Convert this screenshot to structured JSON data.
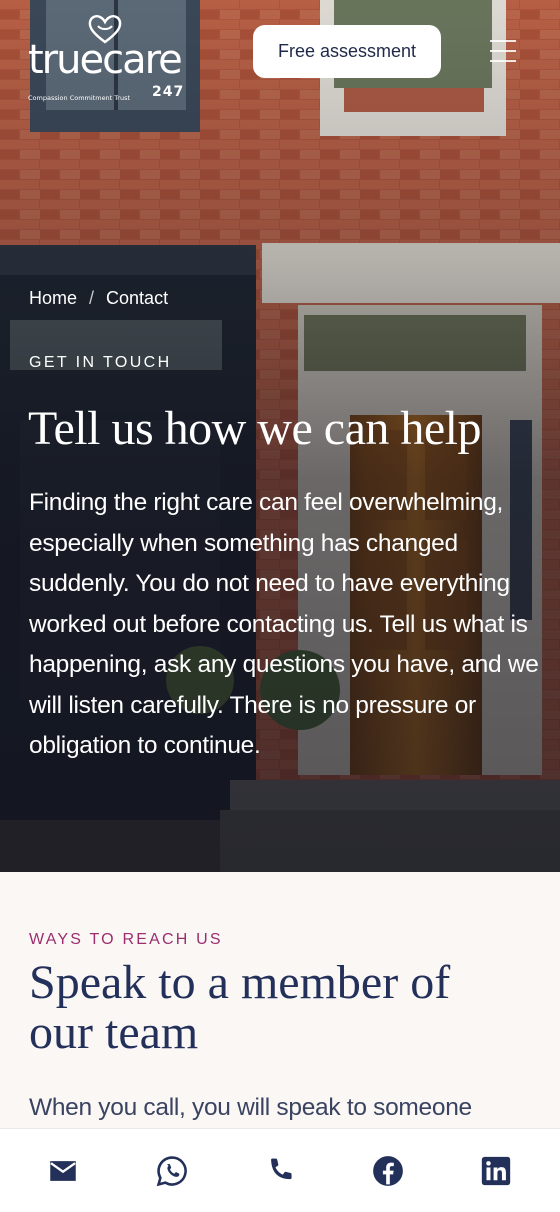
{
  "header": {
    "logo": {
      "wordmark": "truecare",
      "tagline": "Compassion  Commitment  Trust",
      "suffix": "247"
    },
    "cta_label": "Free assessment",
    "menu_icon": "menu-icon"
  },
  "hero": {
    "breadcrumb": {
      "home": "Home",
      "separator": "/",
      "current": "Contact"
    },
    "eyebrow": "GET IN TOUCH",
    "title": "Tell us how we can help",
    "body": "Finding the right care can feel overwhelming, especially when something has changed suddenly. You do not need to have everything worked out before contacting us. Tell us what is happening, ask any questions you have, and we will listen carefully. There is no pressure or obligation to continue."
  },
  "reach": {
    "eyebrow": "WAYS TO REACH US",
    "title": "Speak to a member of our team",
    "body": "When you call, you will speak to someone"
  },
  "bottom_bar": {
    "items": [
      {
        "icon": "email-icon"
      },
      {
        "icon": "whatsapp-icon"
      },
      {
        "icon": "phone-icon"
      },
      {
        "icon": "facebook-icon"
      },
      {
        "icon": "linkedin-icon"
      }
    ],
    "icon_color": "#23305a"
  },
  "colors": {
    "navy": "#23305a",
    "accent_pink": "#9b2e6e",
    "page_bg": "#faf7f5",
    "brick": "#a9503a"
  }
}
